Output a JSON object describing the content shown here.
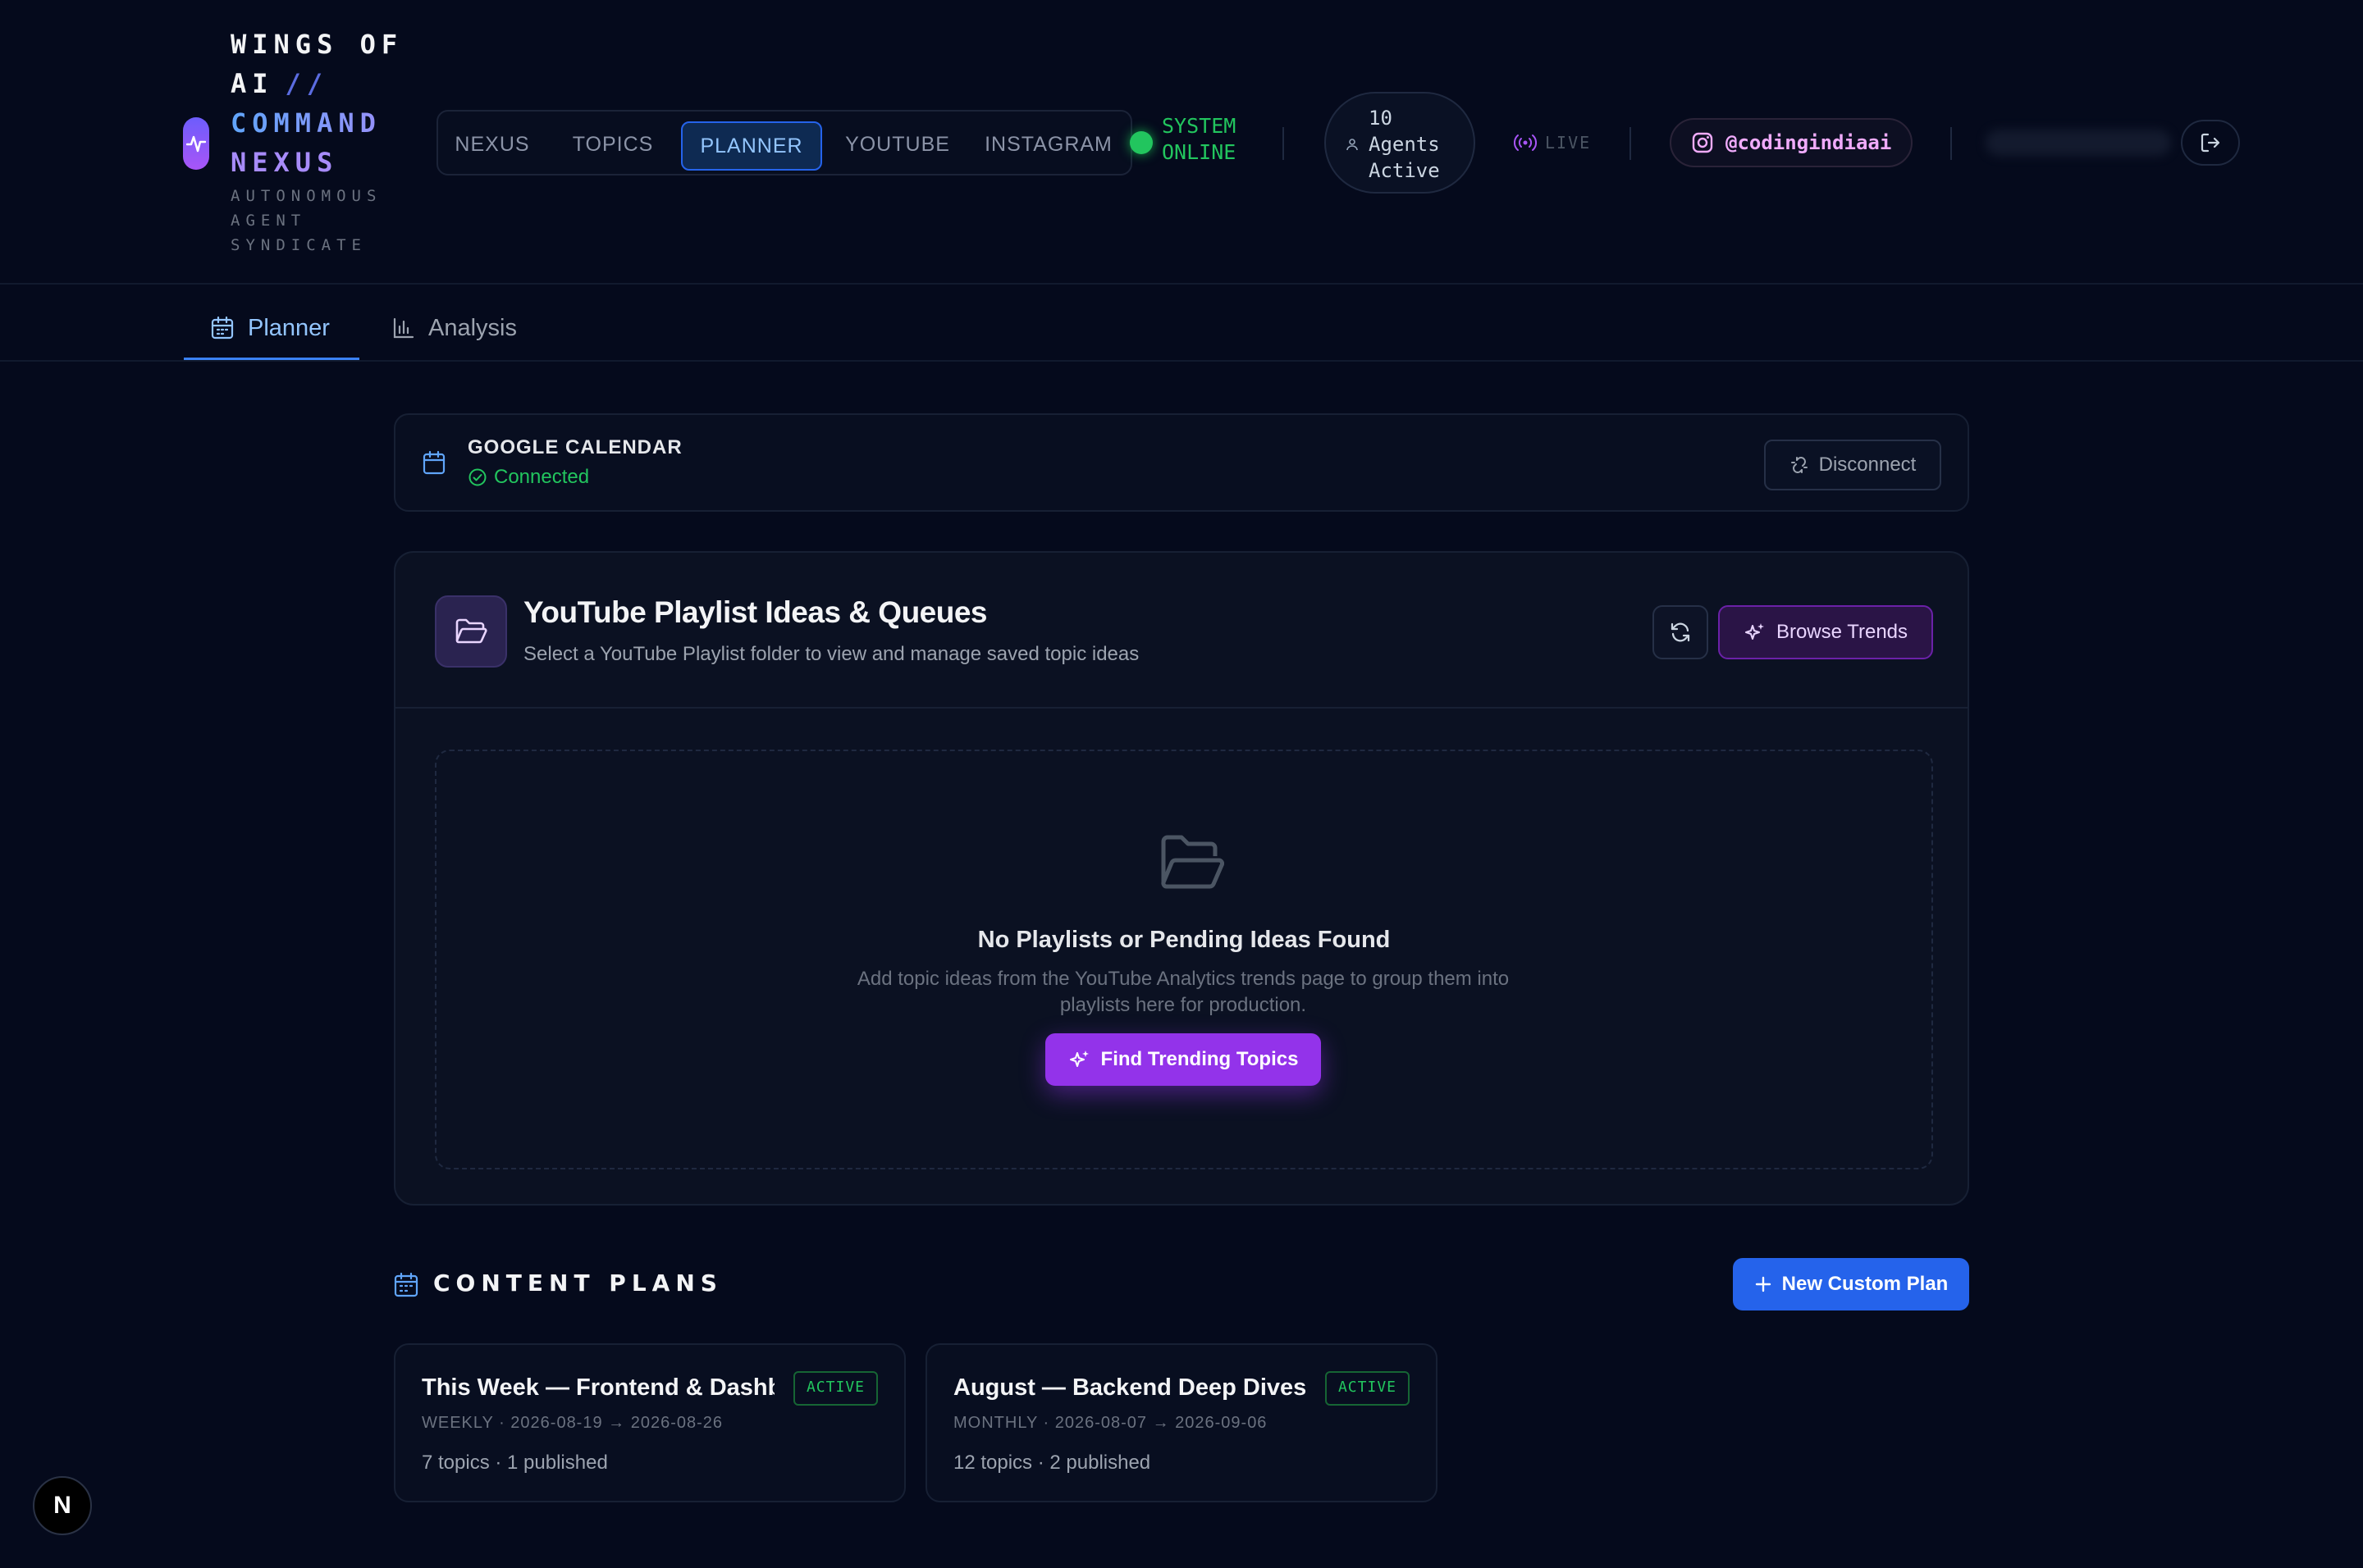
{
  "brand": {
    "line1": "WINGS OF",
    "line2": "AI",
    "slashes": "//",
    "line3": "COMMAND",
    "line4": "NEXUS",
    "tagline1": "AUTONOMOUS",
    "tagline2": "AGENT",
    "tagline3": "SYNDICATE"
  },
  "nav": {
    "items": [
      {
        "label": "NEXUS"
      },
      {
        "label": "TOPICS"
      },
      {
        "label": "PLANNER",
        "active": true
      },
      {
        "label": "YOUTUBE"
      },
      {
        "label": "INSTAGRAM"
      }
    ]
  },
  "status": {
    "line1": "SYSTEM",
    "line2": "ONLINE",
    "color": "#22c55e"
  },
  "agents": {
    "count": "10",
    "line2": "Agents",
    "line3": "Active"
  },
  "live": {
    "label": "LIVE"
  },
  "instagram": {
    "handle": "@codingindiaai",
    "icon": "instagram-icon"
  },
  "tabs": [
    {
      "label": "Planner",
      "icon": "calendar-icon",
      "active": true
    },
    {
      "label": "Analysis",
      "icon": "bar-chart-icon"
    }
  ],
  "calendar": {
    "title": "GOOGLE CALENDAR",
    "status": "Connected",
    "disconnect_label": "Disconnect"
  },
  "playlists": {
    "title": "YouTube Playlist Ideas & Queues",
    "subtitle": "Select a YouTube Playlist folder to view and manage saved topic ideas",
    "browse_label": "Browse Trends",
    "empty_title": "No Playlists or Pending Ideas Found",
    "empty_desc": "Add topic ideas from the YouTube Analytics trends page to group them into playlists here for production.",
    "find_label": "Find Trending Topics"
  },
  "content_plans": {
    "title": "CONTENT PLANS",
    "new_label": "New Custom Plan",
    "plans": [
      {
        "name": "This Week — Frontend & Dashb...",
        "badge": "ACTIVE",
        "meta": "WEEKLY · 2026-08-19 → 2026-08-26",
        "stats": "7 topics · 1 published"
      },
      {
        "name": "August — Backend Deep Dives",
        "badge": "ACTIVE",
        "meta": "MONTHLY · 2026-08-07 → 2026-09-06",
        "stats": "12 topics · 2 published"
      }
    ]
  },
  "dev_badge": {
    "label": "N"
  },
  "colors": {
    "background": "#050a1c",
    "accent_blue": "#2563eb",
    "accent_purple": "#9333ea",
    "success": "#22c55e"
  }
}
